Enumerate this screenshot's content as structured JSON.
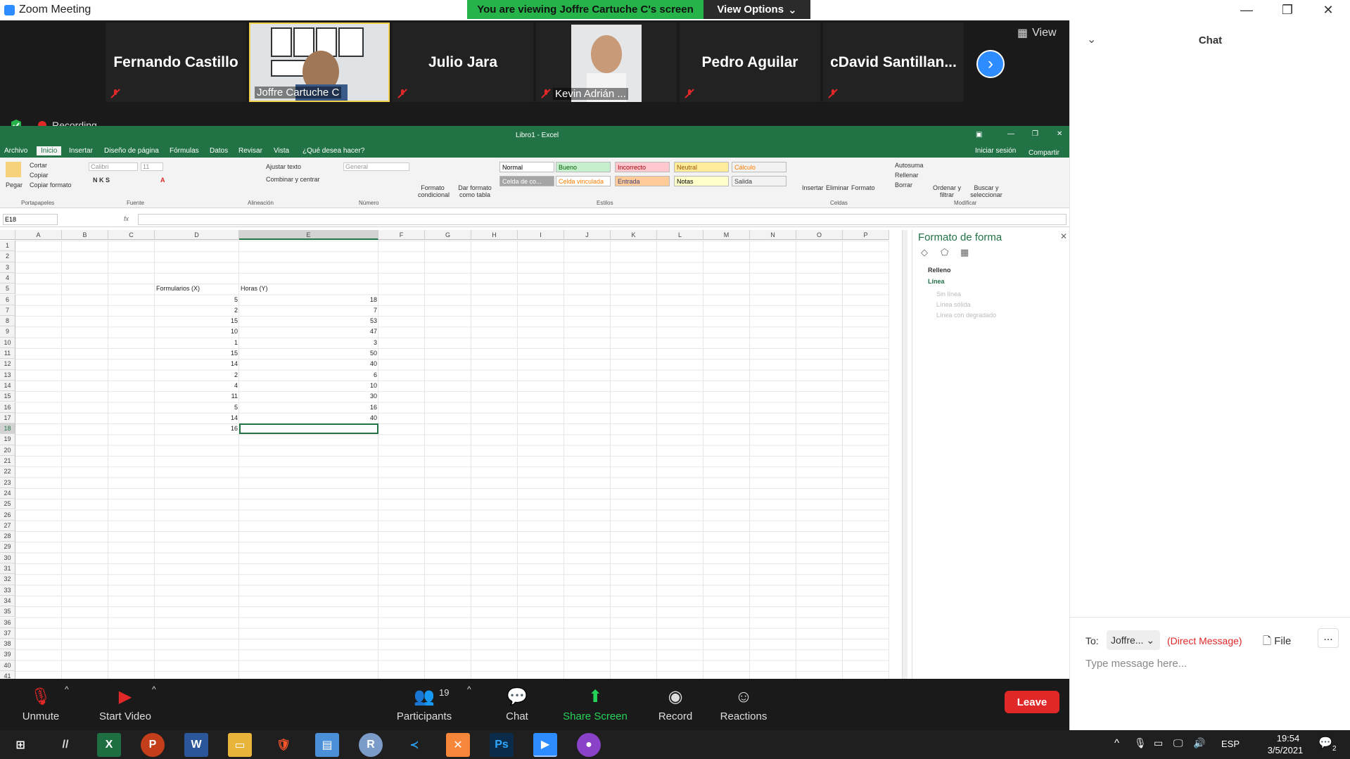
{
  "titlebar": {
    "app_title": "Zoom Meeting",
    "viewing_banner": "You are viewing Joffre Cartuche C's screen",
    "view_options": "View Options"
  },
  "gallery": {
    "participants": [
      {
        "name": "Fernando Castillo",
        "video": false
      },
      {
        "name": "Joffre Cartuche C",
        "video": true
      },
      {
        "name": "Julio Jara",
        "video": false
      },
      {
        "name": "Kevin Adrián ...",
        "video": true
      },
      {
        "name": "Pedro Aguilar",
        "video": false
      },
      {
        "name": "cDavid  Santillan...",
        "video": false
      }
    ],
    "view_label": "View",
    "recording_label": "Recording"
  },
  "excel": {
    "window_title": "Libro1 - Excel",
    "signin": "Iniciar sesión",
    "share": "Compartir",
    "tabs": [
      "Archivo",
      "Inicio",
      "Insertar",
      "Diseño de página",
      "Fórmulas",
      "Datos",
      "Revisar",
      "Vista",
      "¿Qué desea hacer?"
    ],
    "active_tab": "Inicio",
    "ribbon": {
      "paste": "Pegar",
      "cut": "Cortar",
      "copy": "Copiar",
      "copy_format": "Copiar formato",
      "font_name": "Calibri",
      "font_size": "11",
      "wrap": "Ajustar texto",
      "merge": "Combinar y centrar",
      "number_format": "General",
      "cond_format": "Formato condicional",
      "format_table": "Dar formato como tabla",
      "styles": [
        {
          "label": "Normal",
          "bg": "#ffffff",
          "fg": "#000000"
        },
        {
          "label": "Bueno",
          "bg": "#c6efce",
          "fg": "#006100"
        },
        {
          "label": "Incorrecto",
          "bg": "#ffc7ce",
          "fg": "#9c0006"
        },
        {
          "label": "Neutral",
          "bg": "#ffeb9c",
          "fg": "#9c5700"
        },
        {
          "label": "Cálculo",
          "bg": "#f2f2f2",
          "fg": "#fa7d00"
        },
        {
          "label": "Celda de co...",
          "bg": "#a5a5a5",
          "fg": "#ffffff"
        },
        {
          "label": "Celda vinculada",
          "bg": "#ffffff",
          "fg": "#fa7d00"
        },
        {
          "label": "Entrada",
          "bg": "#ffcc99",
          "fg": "#3f3f76"
        },
        {
          "label": "Notas",
          "bg": "#ffffcc",
          "fg": "#000000"
        },
        {
          "label": "Salida",
          "bg": "#f2f2f2",
          "fg": "#3f3f3f"
        }
      ],
      "insert": "Insertar",
      "delete": "Eliminar",
      "format": "Formato",
      "autosum": "Autosuma",
      "fill": "Rellenar",
      "clear": "Borrar",
      "sort": "Ordenar y filtrar",
      "find": "Buscar y seleccionar",
      "groups": [
        "Portapapeles",
        "Fuente",
        "Alineación",
        "Número",
        "Estilos",
        "Celdas",
        "Modificar"
      ]
    },
    "name_box": "E18",
    "fx": "fx",
    "columns": [
      "A",
      "B",
      "C",
      "D",
      "E",
      "F",
      "G",
      "H",
      "I",
      "J",
      "K",
      "L",
      "M",
      "N",
      "O",
      "P"
    ],
    "rows": [
      "1",
      "2",
      "3",
      "4",
      "5",
      "6",
      "7",
      "8",
      "9",
      "10",
      "11",
      "12",
      "13",
      "14",
      "15",
      "16",
      "17",
      "18",
      "19",
      "20",
      "21",
      "22",
      "23",
      "24",
      "25",
      "26",
      "27",
      "28",
      "29",
      "30",
      "31",
      "32",
      "33",
      "34",
      "35",
      "36",
      "37",
      "38",
      "39",
      "40",
      "41"
    ],
    "header_d": "Formularios (X)",
    "header_e": "Horas (Y)",
    "d_values": [
      "5",
      "2",
      "15",
      "10",
      "1",
      "15",
      "14",
      "2",
      "4",
      "11",
      "5",
      "14",
      "16"
    ],
    "e_values": [
      "18",
      "7",
      "53",
      "47",
      "3",
      "50",
      "40",
      "6",
      "10",
      "30",
      "16",
      "40",
      ""
    ],
    "pane": {
      "title": "Formato de forma",
      "fill": "Relleno",
      "line": "Línea",
      "options": [
        "Sin línea",
        "Línea sólida",
        "Línea con degradado"
      ]
    }
  },
  "toolbar": {
    "unmute": "Unmute",
    "start_video": "Start Video",
    "participants": "Participants",
    "participants_count": "19",
    "chat": "Chat",
    "share_screen": "Share Screen",
    "record": "Record",
    "reactions": "Reactions",
    "leave": "Leave"
  },
  "chat": {
    "title": "Chat",
    "to_label": "To:",
    "recipient": "Joffre...",
    "direct": "(Direct Message)",
    "file": "File",
    "more": "...",
    "placeholder": "Type message here..."
  },
  "taskbar": {
    "lang": "ESP",
    "time": "19:54",
    "date": "3/5/2021",
    "notifications": "2"
  }
}
